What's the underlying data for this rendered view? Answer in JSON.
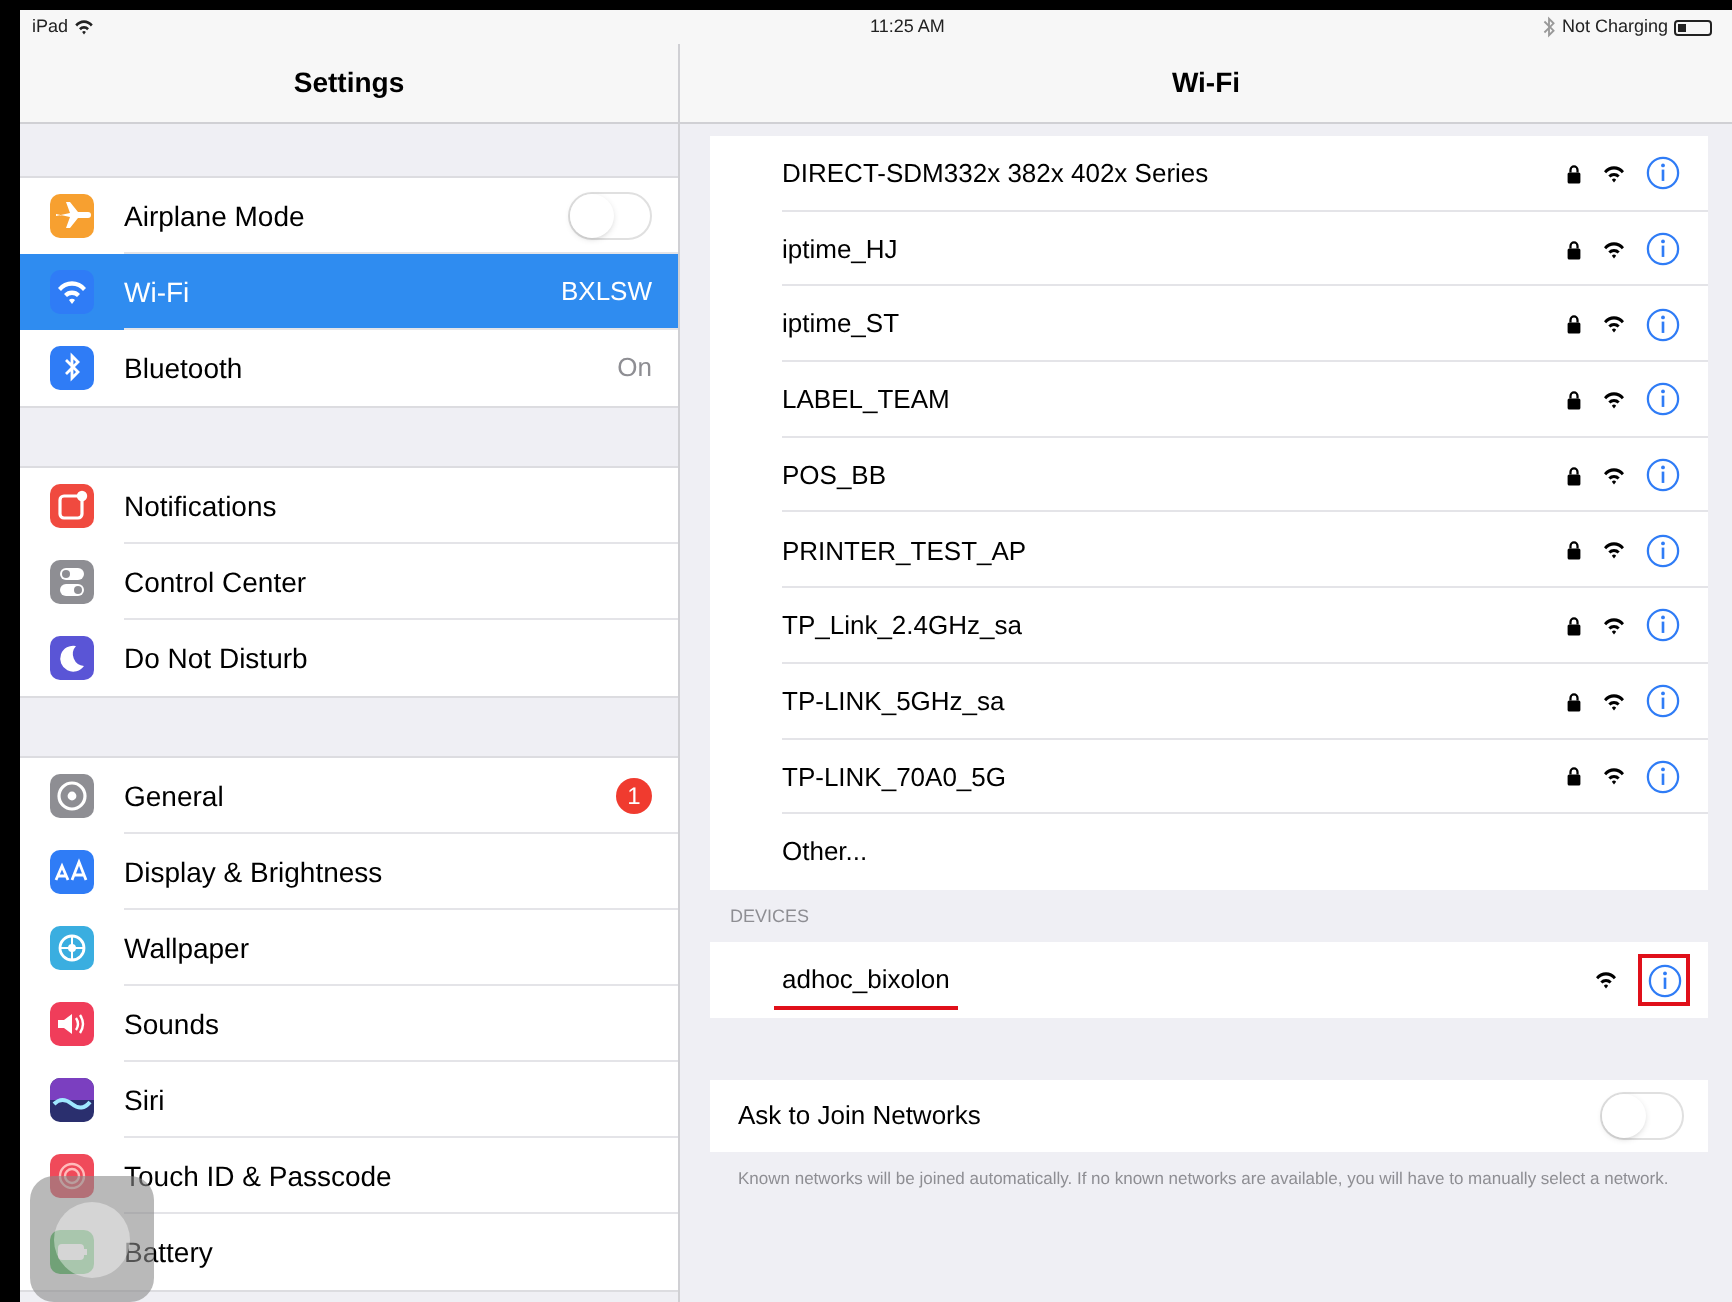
{
  "status_bar": {
    "device": "iPad",
    "time": "11:25 AM",
    "battery_text": "Not Charging"
  },
  "sidebar": {
    "title": "Settings",
    "groups": [
      [
        {
          "label": "Airplane Mode",
          "kind": "toggle",
          "on": false,
          "selected": false
        },
        {
          "label": "Wi-Fi",
          "kind": "value",
          "value": "BXLSW",
          "selected": true
        },
        {
          "label": "Bluetooth",
          "kind": "value",
          "value": "On",
          "selected": false
        }
      ],
      [
        {
          "label": "Notifications",
          "kind": "plain",
          "selected": false
        },
        {
          "label": "Control Center",
          "kind": "plain",
          "selected": false
        },
        {
          "label": "Do Not Disturb",
          "kind": "plain",
          "selected": false
        }
      ],
      [
        {
          "label": "General",
          "kind": "badge",
          "badge": "1",
          "selected": false
        },
        {
          "label": "Display & Brightness",
          "kind": "plain",
          "selected": false
        },
        {
          "label": "Wallpaper",
          "kind": "plain",
          "selected": false
        },
        {
          "label": "Sounds",
          "kind": "plain",
          "selected": false
        },
        {
          "label": "Siri",
          "kind": "plain",
          "selected": false
        },
        {
          "label": "Touch ID & Passcode",
          "kind": "plain",
          "selected": false
        },
        {
          "label": "Battery",
          "kind": "plain",
          "selected": false
        }
      ]
    ]
  },
  "wifi": {
    "title": "Wi-Fi",
    "networks": [
      {
        "name": "DIRECT-SDM332x 382x 402x Series",
        "locked": true
      },
      {
        "name": "iptime_HJ",
        "locked": true
      },
      {
        "name": "iptime_ST",
        "locked": true
      },
      {
        "name": "LABEL_TEAM",
        "locked": true
      },
      {
        "name": "POS_BB",
        "locked": true
      },
      {
        "name": "PRINTER_TEST_AP",
        "locked": true
      },
      {
        "name": "TP_Link_2.4GHz_sa",
        "locked": true
      },
      {
        "name": "TP-LINK_5GHz_sa",
        "locked": true
      },
      {
        "name": "TP-LINK_70A0_5G",
        "locked": true
      }
    ],
    "other": "Other...",
    "devices_header": "DEVICES",
    "devices": [
      {
        "name": "adhoc_bixolon",
        "locked": false,
        "underlined": true,
        "info_boxed": true
      }
    ],
    "ask_to_join": {
      "label": "Ask to Join Networks",
      "on": false
    },
    "footnote": "Known networks will be joined automatically. If no known networks are available, you will have to manually select a network."
  },
  "assistive_touch": {
    "kind": "floating"
  }
}
